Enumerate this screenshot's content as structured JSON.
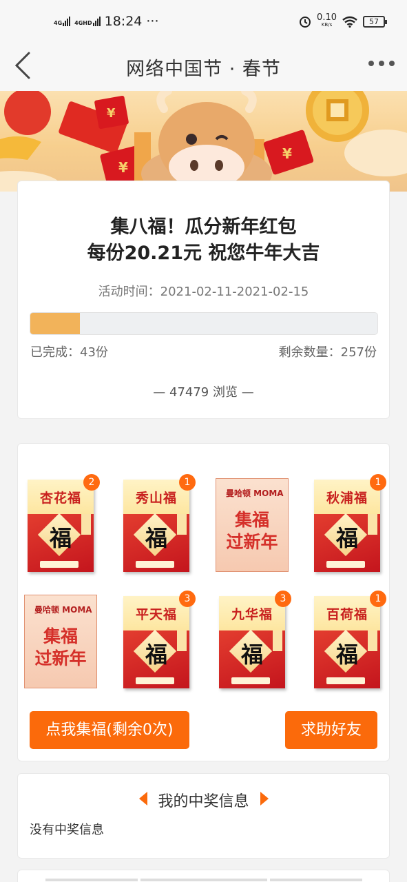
{
  "status_bar": {
    "signal_1": "4G",
    "signal_2": "4GHD",
    "time": "18:24",
    "more": "···",
    "speed_value": "0.10",
    "speed_unit": "KB/s",
    "battery": "57"
  },
  "nav": {
    "title": "网络中国节 · 春节"
  },
  "activity": {
    "title_line1": "集八福！瓜分新年红包",
    "title_line2": "每份20.21元 祝您牛年大吉",
    "time_label": "活动时间：",
    "time_range": "2021-02-11-2021-02-15",
    "completed_text": "已完成：43份",
    "remaining_text": "剩余数量：257份",
    "progress_fraction": 0.143,
    "views_text": "— 47479 浏览 —"
  },
  "fu_cards": [
    {
      "name": "杏花福",
      "char": "福",
      "badge": "2"
    },
    {
      "name": "秀山福",
      "char": "福",
      "badge": "1"
    },
    {
      "name": "集福过新年",
      "promo": true
    },
    {
      "name": "秋浦福",
      "char": "福",
      "badge": "1"
    },
    {
      "name": "集福过新年",
      "promo": true
    },
    {
      "name": "平天福",
      "char": "福",
      "badge": "3"
    },
    {
      "name": "九华福",
      "char": "福",
      "badge": "3"
    },
    {
      "name": "百荷福",
      "char": "福",
      "badge": "1"
    }
  ],
  "promo": {
    "brand": "曼哈顿 MOMA",
    "line1": "集福",
    "line2": "过新年"
  },
  "buttons": {
    "collect": "点我集福(剩余0次)",
    "help": "求助好友"
  },
  "prize": {
    "title": "我的中奖信息",
    "empty": "没有中奖信息"
  },
  "colors": {
    "accent": "#fb6a0b",
    "progress": "#f2b35a",
    "card_red": "#c4151d"
  }
}
